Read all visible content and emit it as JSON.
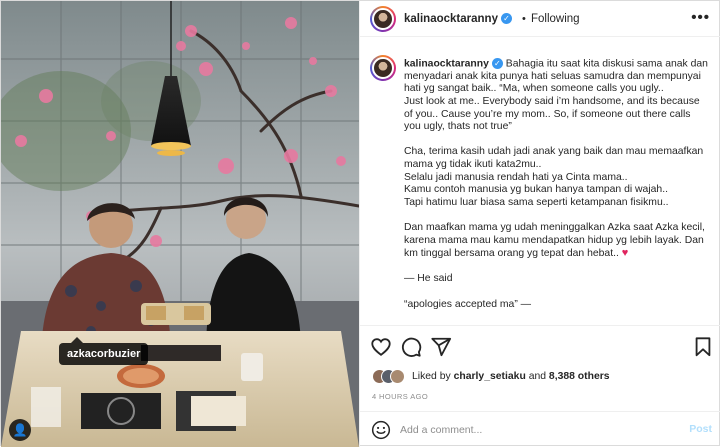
{
  "post": {
    "username": "kalinaocktaranny",
    "verified_glyph": "✓",
    "separator": "•",
    "follow_status": "Following",
    "more_glyph": "•••",
    "photo_tag": "azkacorbuzier",
    "tag_icon_glyph": "👤"
  },
  "caption": {
    "username": "kalinaocktaranny",
    "paragraphs": [
      "Bahagia itu saat kita diskusi sama anak dan menyadari anak kita punya hati seluas samudra dan mempunyai hati yg sangat baik.. “Ma, when someone calls you ugly..\nJust look at me.. Everybody said i’m handsome, and its because of you.. Cause you’re my mom.. So, if someone out there calls you ugly, thats not true”",
      "Cha, terima kasih udah jadi anak yang baik dan mau memaafkan mama yg tidak ikuti kata2mu..\nSelalu jadi manusia rendah hati ya Cinta mama..\nKamu contoh manusia yg bukan hanya tampan di wajah..\nTapi hatimu luar biasa sama seperti ketampanan fisikmu..",
      "Dan maafkan mama yg udah meninggalkan Azka saat Azka kecil, karena mama mau kamu mendapatkan hidup yg lebih layak. Dan km tinggal bersama orang yg tepat dan hebat..",
      "— He said",
      "“apologies accepted ma” —"
    ],
    "heart_emoji": "♥"
  },
  "engagement": {
    "liked_by_prefix": "Liked by",
    "liked_by_user": "charly_setiaku",
    "and_text": "and",
    "others_count": "8,388 others",
    "timestamp": "4 HOURS AGO"
  },
  "comment": {
    "placeholder": "Add a comment...",
    "post_label": "Post"
  },
  "colors": {
    "link_blue": "#3897f0",
    "post_disabled": "#b2dffc",
    "heart_red": "#e0245e",
    "blossom_pink": "#e77aa0"
  }
}
